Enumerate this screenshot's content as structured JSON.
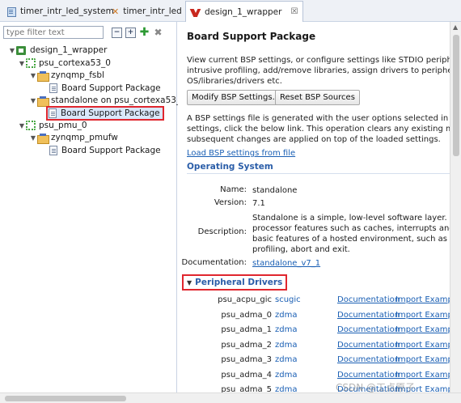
{
  "tabs": [
    {
      "label": "timer_intr_led_system",
      "icon": "editor-icon",
      "active": false
    },
    {
      "label": "timer_intr_led",
      "icon": "tools-icon",
      "active": false
    },
    {
      "label": "design_1_wrapper",
      "icon": "xilinx-logo-icon",
      "active": true,
      "close": "☒"
    }
  ],
  "explorer": {
    "filter_placeholder": "type filter text",
    "tree": [
      {
        "label": "design_1_wrapper",
        "icon": "hw-platform-icon",
        "level": 0,
        "expanded": true
      },
      {
        "label": "psu_cortexa53_0",
        "icon": "processor-icon",
        "level": 1,
        "expanded": true
      },
      {
        "label": "zynqmp_fsbl",
        "icon": "folder-icon",
        "level": 2,
        "expanded": true
      },
      {
        "label": "Board Support Package",
        "icon": "file-icon",
        "level": 3
      },
      {
        "label": "standalone on psu_cortexa53_0",
        "icon": "folder-icon",
        "level": 2,
        "expanded": true
      },
      {
        "label": "Board Support Package",
        "icon": "file-icon",
        "level": 3,
        "selected": true
      },
      {
        "label": "psu_pmu_0",
        "icon": "processor-icon",
        "level": 1,
        "expanded": true
      },
      {
        "label": "zynqmp_pmufw",
        "icon": "folder-icon",
        "level": 2,
        "expanded": true
      },
      {
        "label": "Board Support Package",
        "icon": "file-icon",
        "level": 3
      }
    ]
  },
  "bsp": {
    "title": "Board Support Package",
    "intro": [
      "View current BSP settings, or configure settings like STDIO peripheral sel",
      "intrusive profiling, add/remove libraries, assign drivers to peripherals, ch",
      "OS/libraries/drivers etc."
    ],
    "modify_button": "Modify BSP Settings...",
    "reset_button": "Reset BSP Sources",
    "load_note": [
      "A BSP settings file is generated with the user options selected in the setti",
      "settings, click the below link. This operation clears any existing modificati",
      "subsequent changes are applied on top of the loaded settings."
    ],
    "load_link": "Load BSP settings from file",
    "os_section": "Operating System",
    "os": {
      "name_label": "Name:",
      "name": "standalone",
      "version_label": "Version:",
      "version": "7.1",
      "description_label": "Description:",
      "description": [
        "Standalone is a simple, low-level software layer. It prov",
        "processor features such as caches, interrupts and exce",
        "basic features of a hosted environment, such as standa",
        "profiling, abort and exit."
      ],
      "documentation_label": "Documentation:",
      "documentation_link": "standalone_v7_1"
    },
    "drivers_section": "Peripheral Drivers",
    "drivers": [
      {
        "name": "psu_acpu_gic",
        "driver": "scugic",
        "doc": "Documentation",
        "import": "Import Exampl"
      },
      {
        "name": "psu_adma_0",
        "driver": "zdma",
        "doc": "Documentation",
        "import": "Import Exampl"
      },
      {
        "name": "psu_adma_1",
        "driver": "zdma",
        "doc": "Documentation",
        "import": "Import Exampl"
      },
      {
        "name": "psu_adma_2",
        "driver": "zdma",
        "doc": "Documentation",
        "import": "Import Exampl"
      },
      {
        "name": "psu_adma_3",
        "driver": "zdma",
        "doc": "Documentation",
        "import": "Import Exampl"
      },
      {
        "name": "psu_adma_4",
        "driver": "zdma",
        "doc": "Documentation",
        "import": "Import Exampl"
      },
      {
        "name": "psu_adma_5",
        "driver": "zdma",
        "doc": "Documentation",
        "import": "Import Exampl"
      }
    ]
  },
  "watermark": "CSDN @工点原子",
  "colors": {
    "link": "#1a5fb4",
    "section": "#2a5da8",
    "highlight": "#e0262e",
    "selection": "#d9e8fb"
  }
}
